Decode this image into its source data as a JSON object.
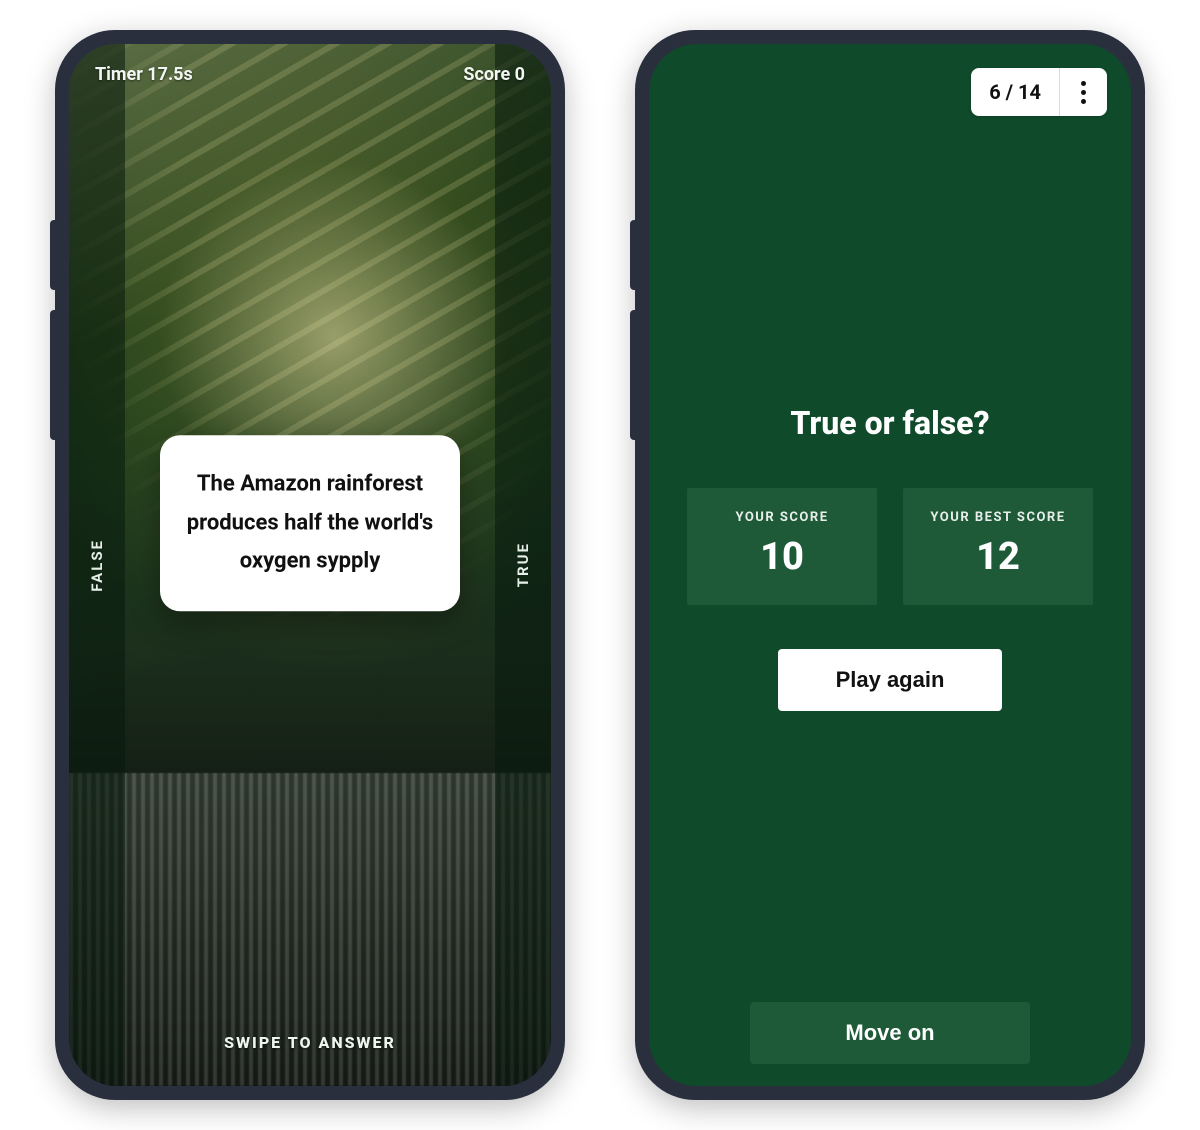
{
  "left": {
    "timer_label": "Timer 17.5s",
    "score_label": "Score 0",
    "false_label": "FALSE",
    "true_label": "TRUE",
    "question": "The Amazon rainforest produces half the world's oxygen sypply",
    "swipe_hint": "SWIPE TO ANSWER"
  },
  "right": {
    "progress": "6 / 14",
    "title": "True or false?",
    "your_score_label": "YOUR SCORE",
    "your_score_value": "10",
    "best_score_label": "YOUR BEST SCORE",
    "best_score_value": "12",
    "play_again": "Play again",
    "move_on": "Move on"
  },
  "colors": {
    "brand_green": "#0f4a2b",
    "panel_green": "#1e5a38"
  }
}
